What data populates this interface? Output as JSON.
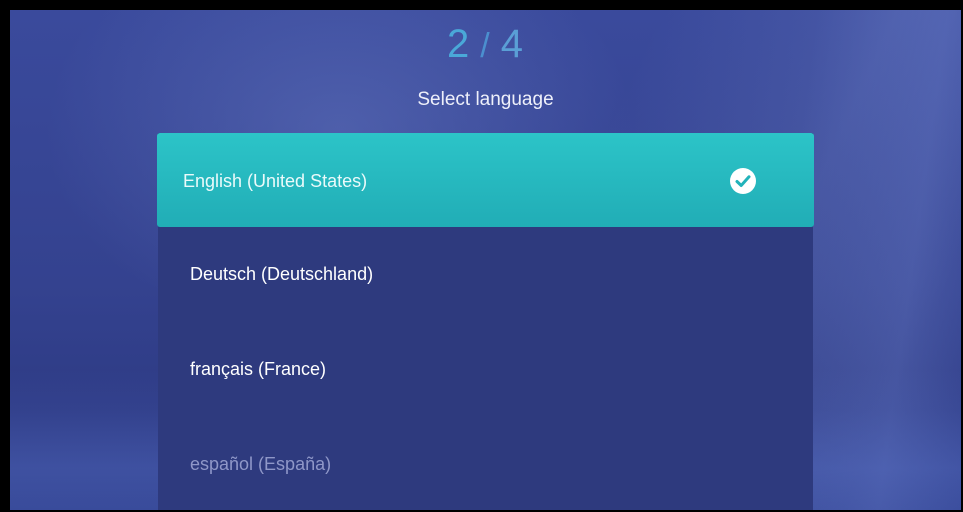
{
  "setup": {
    "step_current": "2",
    "step_separator": "/",
    "step_total": "4",
    "title": "Select language"
  },
  "languages": [
    {
      "label": "English (United States)",
      "selected": true
    },
    {
      "label": "Deutsch (Deutschland)",
      "selected": false
    },
    {
      "label": "français (France)",
      "selected": false
    },
    {
      "label": "español (España)",
      "selected": false
    }
  ],
  "icons": {
    "selected_indicator": "check-circle-icon"
  },
  "colors": {
    "background": "#33418f",
    "list_background": "#2e3a7e",
    "selected_highlight": "#2cc4c8",
    "step_number": "#4aa8d8"
  }
}
